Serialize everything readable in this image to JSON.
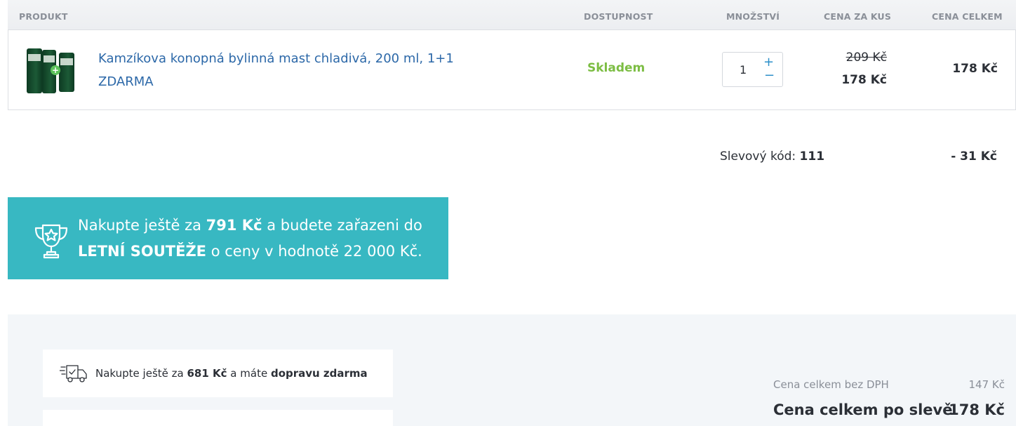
{
  "table_header": {
    "product": "PRODUKT",
    "availability": "DOSTUPNOST",
    "quantity": "MNOŽSTVÍ",
    "unit_price": "CENA ZA KUS",
    "total_price": "CENA CELKEM"
  },
  "cart_item": {
    "thumbnail_icon": "product-thumbnail-icon",
    "name": "Kamzíkova konopná bylinná mast chladivá, 200 ml, 1+1 ZDARMA",
    "availability": "Skladem",
    "availability_color": "#7cbd43",
    "quantity": "1",
    "increase_symbol": "+",
    "decrease_symbol": "−",
    "price_original": "209 Kč",
    "price_unit": "178 Kč",
    "price_total": "178 Kč"
  },
  "discount": {
    "label": "Slevový kód:",
    "code": "111",
    "amount": "- 31 Kč"
  },
  "promo_banner": {
    "icon": "trophy-icon",
    "background_color": "#38b8c2",
    "text_1": "Nakupte ještě za ",
    "amount": "791 Kč",
    "text_2": " a budete zařazeni do ",
    "contest": "LETNÍ SOUTĚŽE",
    "text_3": " o ceny v hodnotě 22 000 Kč."
  },
  "shipping_notice": {
    "icon": "delivery-truck-icon",
    "text_1": "Nakupte ještě za ",
    "amount": "681 Kč",
    "text_2": " a máte ",
    "highlight": "dopravu zdarma"
  },
  "summary": {
    "without_vat_label": "Cena celkem bez DPH",
    "without_vat_value": "147 Kč",
    "after_discount_label": "Cena celkem po slevě",
    "after_discount_value": "178 Kč"
  }
}
